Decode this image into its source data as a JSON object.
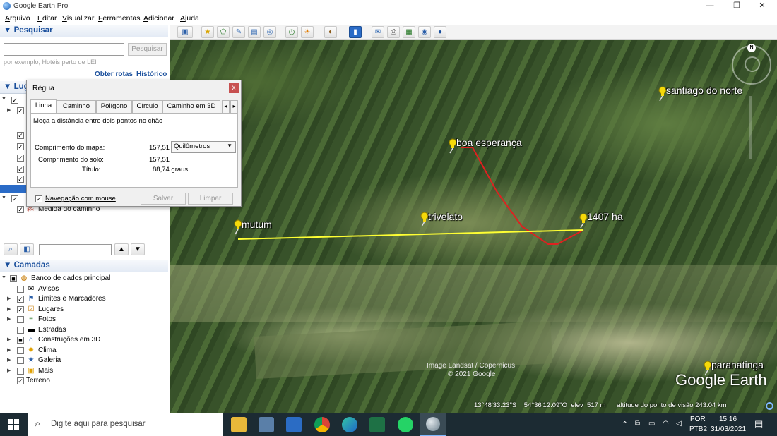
{
  "window": {
    "title": "Google Earth Pro",
    "minimize": "—",
    "maximize": "❐",
    "close": "✕"
  },
  "menu": [
    {
      "pre": "A",
      "rest": "rquivo"
    },
    {
      "pre": "E",
      "rest": "ditar"
    },
    {
      "pre": "V",
      "rest": "isualizar"
    },
    {
      "pre": "F",
      "rest": "erramentas"
    },
    {
      "pre": "A",
      "rest": "dicionar"
    },
    {
      "pre": "A",
      "rest": "juda"
    }
  ],
  "search": {
    "header": "▼ Pesquisar",
    "placeholder": "",
    "button": "Pesquisar",
    "hint": "por exemplo, Hotéis perto de LEI",
    "routes_link": "Obter rotas",
    "history_link": "Histórico"
  },
  "places": {
    "header_partial": "▼ Lug",
    "path_measure": "Medida do caminho"
  },
  "layers": {
    "header": "▼ Camadas",
    "items": [
      {
        "label": "Banco de dados principal",
        "checked": "■"
      },
      {
        "label": "Avisos",
        "checked": ""
      },
      {
        "label": "Limites e Marcadores",
        "checked": "✓"
      },
      {
        "label": "Lugares",
        "checked": "✓"
      },
      {
        "label": "Fotos",
        "checked": ""
      },
      {
        "label": "Estradas",
        "checked": ""
      },
      {
        "label": "Construções em 3D",
        "checked": "■"
      },
      {
        "label": "Clima",
        "checked": ""
      },
      {
        "label": "Galeria",
        "checked": ""
      },
      {
        "label": "Mais",
        "checked": ""
      },
      {
        "label": "Terreno",
        "checked": "✓"
      }
    ]
  },
  "ruler": {
    "title": "Régua",
    "close": "x",
    "tabs": [
      "Linha",
      "Caminho",
      "Polígono",
      "Círculo",
      "Caminho em 3D"
    ],
    "description": "Meça a distância entre dois pontos no chão",
    "map_length_label": "Comprimento do mapa:",
    "map_length_value": "157,51",
    "unit": "Quilômetros",
    "ground_length_label": "Comprimento do solo:",
    "ground_length_value": "157,51",
    "heading_label": "Título:",
    "heading_value": "88,74 graus",
    "mouse_nav": "Navegação com mouse",
    "save": "Salvar",
    "clear": "Limpar"
  },
  "map": {
    "places": [
      "mutum",
      "trivelato",
      "boa esperança",
      "1407 ha",
      "santiago do norte",
      "paranatinga"
    ],
    "attribution_1": "Image Landsat / Copernicus",
    "attribution_2": "© 2021 Google",
    "brand": "Google Earth",
    "status": "13°48'33.23\"S    54°36'12.09\"O  elev  517 m      altitude do ponto de visão 243.04 km",
    "compass_n": "N"
  },
  "taskbar": {
    "search_placeholder": "Digite aqui para pesquisar",
    "lang": "POR",
    "lang2": "PTB2",
    "time": "15:16",
    "date": "31/03/2021"
  }
}
